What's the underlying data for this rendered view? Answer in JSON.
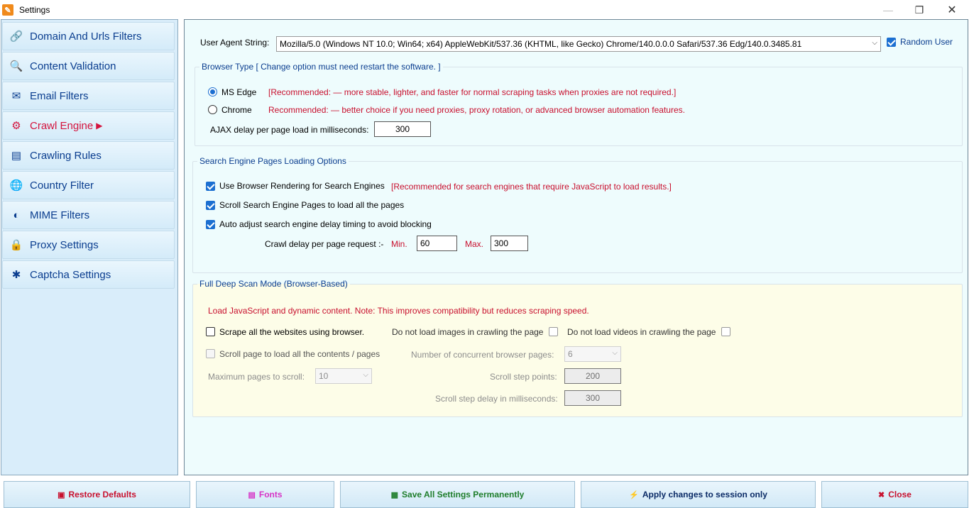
{
  "window": {
    "title": "Settings",
    "icon": "settings-wrench-icon",
    "controls": {
      "minimize": "—",
      "maximize": "❐",
      "close": "✕"
    }
  },
  "sidebar": {
    "items": [
      {
        "label": "Domain And Urls Filters",
        "icon": "link-icon",
        "glyph": "🔗"
      },
      {
        "label": "Content Validation",
        "icon": "magnifier-icon",
        "glyph": "🔍"
      },
      {
        "label": "Email Filters",
        "icon": "email-card-icon",
        "glyph": "✉"
      },
      {
        "label": "Crawl Engine",
        "icon": "gear-engine-icon",
        "glyph": "⚙",
        "active": true,
        "arrow": "▶"
      },
      {
        "label": "Crawling Rules",
        "icon": "rules-card-icon",
        "glyph": "▤"
      },
      {
        "label": "Country Filter",
        "icon": "globe-icon",
        "glyph": "🌐"
      },
      {
        "label": "MIME Filters",
        "icon": "shield-icon",
        "glyph": "◐"
      },
      {
        "label": "Proxy Settings",
        "icon": "lock-icon",
        "glyph": "🔒"
      },
      {
        "label": "Captcha Settings",
        "icon": "puzzle-icon",
        "glyph": "✱"
      }
    ]
  },
  "user_agent": {
    "label": "User Agent String:",
    "value": "Mozilla/5.0 (Windows NT 10.0; Win64; x64) AppleWebKit/537.36 (KHTML, like Gecko) Chrome/140.0.0.0 Safari/537.36 Edg/140.0.3485.81",
    "random_user_label": "Random User",
    "random_user_checked": true
  },
  "browser_type": {
    "title": "Browser Type [ Change option must need restart the software. ]",
    "options": [
      {
        "label": "MS Edge",
        "note": "[Recommended: — more stable, lighter, and faster for normal scraping tasks when proxies are not required.]",
        "selected": true
      },
      {
        "label": "Chrome",
        "note": "Recommended: — better choice if you need proxies, proxy rotation, or advanced browser automation features.",
        "selected": false
      }
    ],
    "ajax_label": "AJAX delay per page load in milliseconds:",
    "ajax_value": "300"
  },
  "search_engine": {
    "title": "Search Engine Pages Loading Options",
    "use_browser_label": "Use Browser Rendering for Search Engines",
    "use_browser_note": "[Recommended for search engines that require JavaScript to load results.]",
    "scroll_label": "Scroll Search Engine Pages to load all the pages",
    "auto_adjust_label": "Auto adjust search engine delay timing to avoid blocking",
    "crawl_delay_label": "Crawl delay per page request :-",
    "min_label": "Min.",
    "min_value": "60",
    "max_label": "Max.",
    "max_value": "300"
  },
  "deep_scan": {
    "title": "Full Deep Scan Mode (Browser-Based)",
    "note": "Load JavaScript and dynamic content. Note: This improves compatibility but reduces scraping speed.",
    "scrape_all_label": "Scrape all the websites using browser.",
    "no_images_label": "Do not load images in crawling the page",
    "no_videos_label": "Do not load videos in crawling the page",
    "scroll_page_label": "Scroll page to load all the contents / pages",
    "concurrent_label": "Number of concurrent browser pages:",
    "concurrent_value": "6",
    "max_scroll_label": "Maximum pages to scroll:",
    "max_scroll_value": "10",
    "step_points_label": "Scroll step points:",
    "step_points_value": "200",
    "step_delay_label": "Scroll step delay in milliseconds:",
    "step_delay_value": "300"
  },
  "footer": {
    "restore": {
      "label": "Restore Defaults",
      "icon": "restore-icon",
      "glyph": "▣",
      "color": "#c8102e"
    },
    "fonts": {
      "label": "Fonts",
      "icon": "fonts-icon",
      "glyph": "▤",
      "color": "#d633c6"
    },
    "save": {
      "label": "Save All Settings Permanently",
      "icon": "save-icon",
      "glyph": "▦",
      "color": "#1e7d2b"
    },
    "apply": {
      "label": "Apply changes to session only",
      "icon": "lightning-icon",
      "glyph": "⚡",
      "color": "#0a2a66"
    },
    "close": {
      "label": "Close",
      "icon": "close-x-icon",
      "glyph": "✖",
      "color": "#c8102e"
    }
  }
}
